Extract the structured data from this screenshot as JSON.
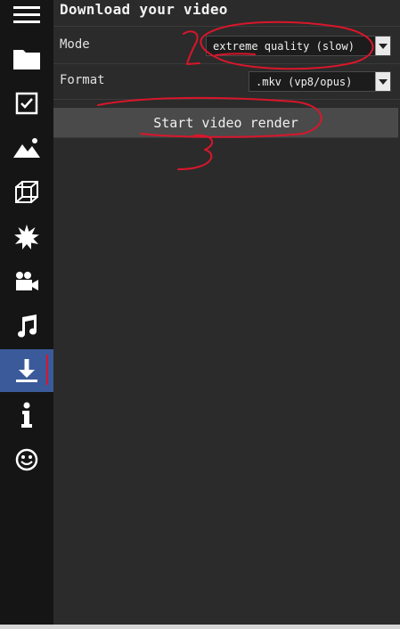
{
  "sidebar": {
    "items": [
      {
        "icon": "menu-icon"
      },
      {
        "icon": "folder-icon"
      },
      {
        "icon": "checkbox-icon"
      },
      {
        "icon": "image-mountains-icon"
      },
      {
        "icon": "cube-wireframe-icon"
      },
      {
        "icon": "starburst-icon"
      },
      {
        "icon": "video-camera-icon"
      },
      {
        "icon": "music-note-icon"
      },
      {
        "icon": "download-icon",
        "active": true
      },
      {
        "icon": "info-icon"
      },
      {
        "icon": "smiley-icon"
      }
    ],
    "active_color": "#3b5a9a"
  },
  "panel": {
    "title": "Download your video",
    "mode": {
      "label": "Mode",
      "value": "extreme quality (slow)"
    },
    "format": {
      "label": "Format",
      "value": ".mkv (vp8/opus)"
    },
    "render_button": "Start video render"
  },
  "annotations": {
    "color": "#d8162b",
    "labels": [
      "2",
      "3"
    ]
  }
}
